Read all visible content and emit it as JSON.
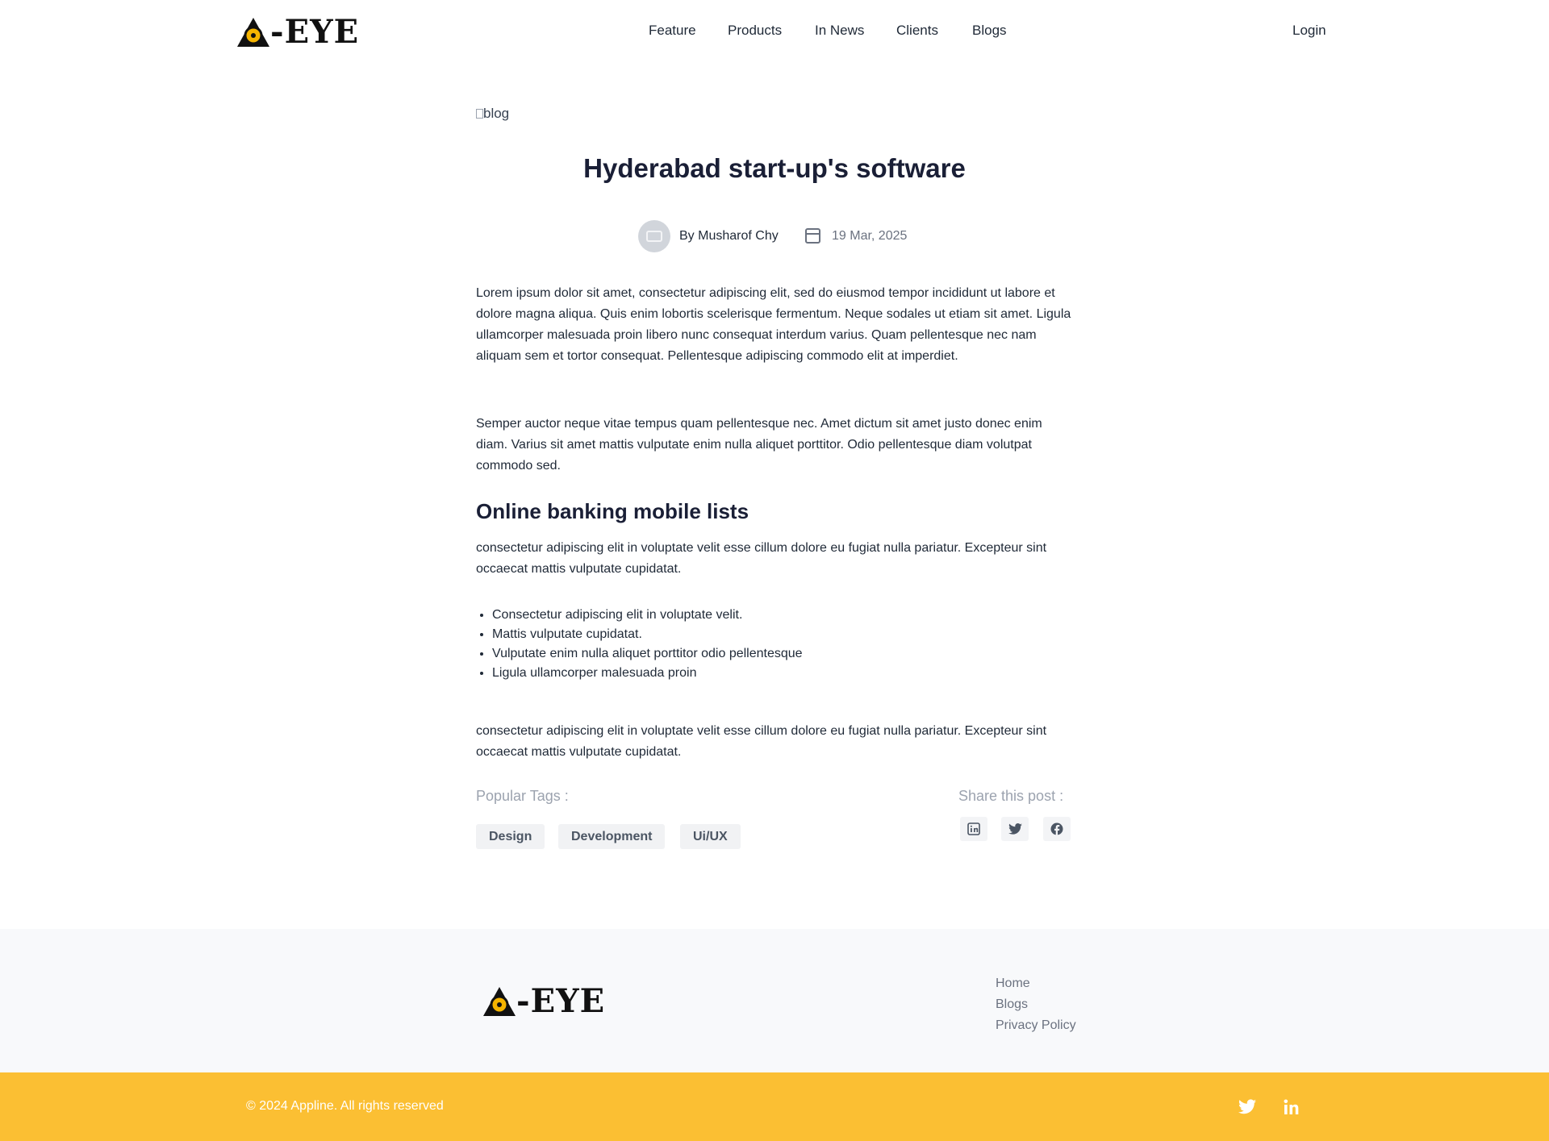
{
  "header": {
    "logo_text": "-EYE",
    "nav": [
      "Feature",
      "Products",
      "In News",
      "Clients",
      "Blogs"
    ],
    "login": "Login"
  },
  "article": {
    "image_alt": "blog",
    "title": "Hyderabad start-up's software",
    "author": "By Musharof Chy",
    "date": "19 Mar, 2025",
    "paragraphs": [
      "Lorem ipsum dolor sit amet, consectetur adipiscing elit, sed do eiusmod tempor incididunt ut labore et dolore magna aliqua. Quis enim lobortis scelerisque fermentum. Neque sodales ut etiam sit amet. Ligula ullamcorper malesuada proin libero nunc consequat interdum varius. Quam pellentesque nec nam aliquam sem et tortor consequat. Pellentesque adipiscing commodo elit at imperdiet.",
      "Semper auctor neque vitae tempus quam pellentesque nec. Amet dictum sit amet justo donec enim diam. Varius sit amet mattis vulputate enim nulla aliquet porttitor. Odio pellentesque diam volutpat commodo sed.",
      "consectetur adipiscing elit in voluptate velit esse cillum dolore eu fugiat nulla pariatur. Excepteur sint occaecat mattis vulputate cupidatat.",
      "consectetur adipiscing elit in voluptate velit esse cillum dolore eu fugiat nulla pariatur. Excepteur sint occaecat mattis vulputate cupidatat."
    ],
    "subheading": "Online banking mobile lists",
    "list": [
      "Consectetur adipiscing elit in voluptate velit.",
      "Mattis vulputate cupidatat.",
      "Vulputate enim nulla aliquet porttitor odio pellentesque",
      "Ligula ullamcorper malesuada proin"
    ],
    "tags_label": "Popular Tags :",
    "tags": [
      "Design",
      "Development",
      "Ui/UX"
    ],
    "share_label": "Share this post :",
    "share_icons": [
      "linkedin-icon",
      "twitter-icon",
      "facebook-icon"
    ]
  },
  "footer": {
    "logo_text": "-EYE",
    "links": [
      "Home",
      "Blogs",
      "Privacy Policy"
    ],
    "copyright": "© 2024 Appline. All rights reserved",
    "social_icons": [
      "twitter-icon",
      "linkedin-icon"
    ],
    "band_color": "#fbbf33"
  },
  "colors": {
    "logo_accent": "#f5b400",
    "heading": "#1a1f36",
    "muted": "#9ca3af"
  }
}
